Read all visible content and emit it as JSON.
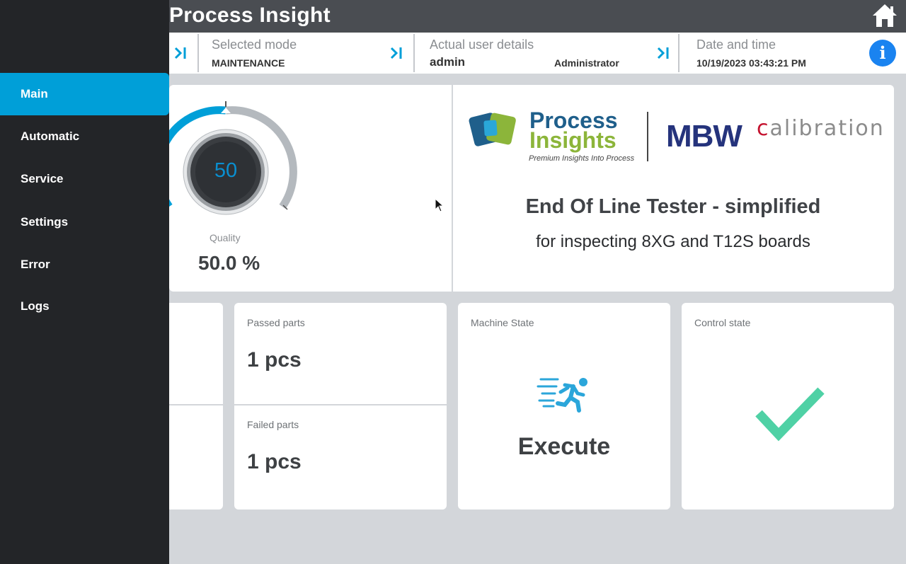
{
  "header": {
    "title": "Process Insight"
  },
  "status": {
    "mode_label": "Selected mode",
    "mode_value": "MAINTENANCE",
    "user_label": "Actual user details",
    "user_name": "admin",
    "user_role": "Administrator",
    "datetime_label": "Date and time",
    "datetime_value": "10/19/2023 03:43:21 PM",
    "info_glyph": "i"
  },
  "sidebar": {
    "items": [
      {
        "label": "Main",
        "active": true
      },
      {
        "label": "Automatic"
      },
      {
        "label": "Service"
      },
      {
        "label": "Settings"
      },
      {
        "label": "Error"
      },
      {
        "label": "Logs"
      }
    ]
  },
  "quality": {
    "gauge_value": "50",
    "label": "Quality",
    "value": "50.0 %",
    "fraction": 0.5
  },
  "brand": {
    "pi_line1": "Process",
    "pi_line2": "Insights",
    "pi_tagline": "Premium Insights Into Process",
    "mbw": "MBW",
    "cal_c": "c",
    "cal_rest": "alibration",
    "title": "End Of Line Tester - simplified",
    "subtitle": "for inspecting 8XG and T12S boards"
  },
  "counts": {
    "passed_label": "Passed parts",
    "passed_value": "1 pcs",
    "failed_label": "Failed parts",
    "failed_value": "1 pcs"
  },
  "machine": {
    "label": "Machine State",
    "value": "Execute",
    "icon": "running-person-icon"
  },
  "control": {
    "label": "Control state",
    "icon": "checkmark-icon"
  },
  "colors": {
    "accent": "#009fd8",
    "sidebar": "#232528",
    "header": "#4a4d52",
    "check": "#4fd1a5",
    "info": "#1a83f0"
  }
}
